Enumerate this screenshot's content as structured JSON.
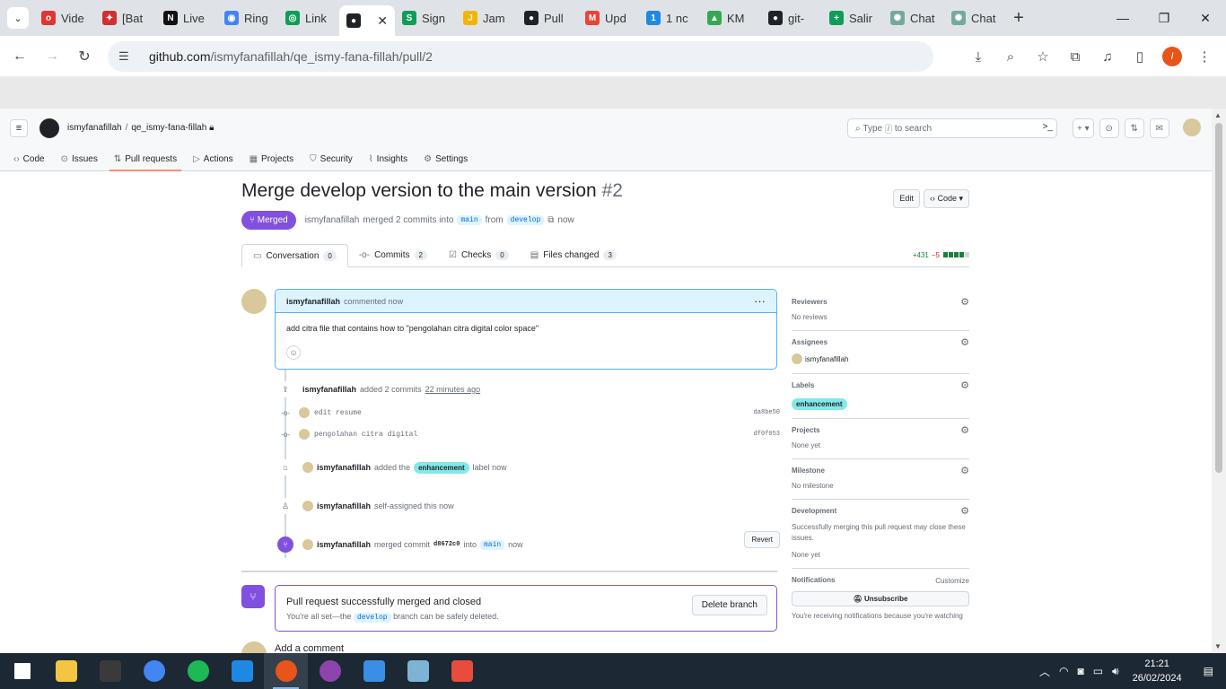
{
  "browser": {
    "tabs": [
      {
        "title": "Vide",
        "color": "#e3342f",
        "glyph": "o"
      },
      {
        "title": "[Bat",
        "color": "#d32f2f",
        "glyph": "✦"
      },
      {
        "title": "Live",
        "color": "#111111",
        "glyph": "N"
      },
      {
        "title": "Ring",
        "color": "#4285f4",
        "glyph": "◉"
      },
      {
        "title": "Link",
        "color": "#0f9d58",
        "glyph": "◎"
      },
      {
        "title": "",
        "color": "#1f2328",
        "glyph": "●",
        "active": true
      },
      {
        "title": "Sign",
        "color": "#0f9d58",
        "glyph": "S"
      },
      {
        "title": "Jam",
        "color": "#f4b400",
        "glyph": "J"
      },
      {
        "title": "Pull",
        "color": "#1f2328",
        "glyph": "●"
      },
      {
        "title": "Upd",
        "color": "#ea4335",
        "glyph": "M"
      },
      {
        "title": "1 nc",
        "color": "#1e88e5",
        "glyph": "1"
      },
      {
        "title": "KM",
        "color": "#34a853",
        "glyph": "▲"
      },
      {
        "title": "git-",
        "color": "#1f2328",
        "glyph": "●"
      },
      {
        "title": "Salir",
        "color": "#0f9d58",
        "glyph": "+"
      },
      {
        "title": "Chat",
        "color": "#74aa9c",
        "glyph": "✺"
      },
      {
        "title": "Chat",
        "color": "#74aa9c",
        "glyph": "✺"
      }
    ],
    "url_host": "github.com",
    "url_path": "/ismyfanafillah/qe_ismy-fana-fillah/pull/2",
    "profile_initial": "I"
  },
  "github": {
    "owner": "ismyfanafillah",
    "repo": "qe_ismy-fana-fillah",
    "search_placeholder_a": "Type",
    "search_placeholder_key": "/",
    "search_placeholder_b": "to search",
    "nav": [
      {
        "icon": "code-icon",
        "glyph": "‹›",
        "label": "Code"
      },
      {
        "icon": "issues-icon",
        "glyph": "⊙",
        "label": "Issues"
      },
      {
        "icon": "pull-request-icon",
        "glyph": "⇅",
        "label": "Pull requests",
        "selected": true
      },
      {
        "icon": "actions-icon",
        "glyph": "▷",
        "label": "Actions"
      },
      {
        "icon": "projects-icon",
        "glyph": "▦",
        "label": "Projects"
      },
      {
        "icon": "security-icon",
        "glyph": "⛉",
        "label": "Security"
      },
      {
        "icon": "insights-icon",
        "glyph": "⌇",
        "label": "Insights"
      },
      {
        "icon": "settings-icon",
        "glyph": "⚙",
        "label": "Settings"
      }
    ]
  },
  "pr": {
    "title": "Merge develop version to the main version",
    "number": "#2",
    "edit_label": "Edit",
    "code_label": "Code",
    "state": "Merged",
    "author": "ismyfanafillah",
    "merged_text": "merged 2 commits into",
    "base": "main",
    "from_text": "from",
    "head": "develop",
    "time": "now",
    "tabs": [
      {
        "label": "Conversation",
        "count": "0",
        "icon": "conversation-icon",
        "glyph": "▭"
      },
      {
        "label": "Commits",
        "count": "2",
        "icon": "commits-icon",
        "glyph": "-o-"
      },
      {
        "label": "Checks",
        "count": "0",
        "icon": "checks-icon",
        "glyph": "☑"
      },
      {
        "label": "Files changed",
        "count": "3",
        "icon": "files-icon",
        "glyph": "▤"
      }
    ],
    "additions": "+431",
    "deletions": "−5",
    "comment": {
      "author": "ismyfanafillah",
      "action": "commented now",
      "body": "add citra file that contains how to \"pengolahan citra digital color space\""
    },
    "commits_event": {
      "author": "ismyfanafillah",
      "text": "added 2 commits",
      "time": "22 minutes ago"
    },
    "commits": [
      {
        "message": "edit resume",
        "sha": "da8be50"
      },
      {
        "message": "pengolahan citra digital",
        "sha": "df0f053"
      }
    ],
    "label_event": {
      "author": "ismyfanafillah",
      "before": "added the",
      "label": "enhancement",
      "after": "label now"
    },
    "assign_event": {
      "author": "ismyfanafillah",
      "text": "self-assigned this now"
    },
    "merge_event": {
      "author": "ismyfanafillah",
      "text": "merged commit",
      "sha": "d8672c0",
      "into": "into",
      "base": "main",
      "time": "now",
      "revert": "Revert"
    },
    "merged_box": {
      "title": "Pull request successfully merged and closed",
      "sub_a": "You're all set—the",
      "branch": "develop",
      "sub_b": "branch can be safely deleted.",
      "delete_label": "Delete branch"
    },
    "add_comment": "Add a comment"
  },
  "sidebar": {
    "reviewers": {
      "h": "Reviewers",
      "v": "No reviews"
    },
    "assignees": {
      "h": "Assignees",
      "v": "ismyfanafillah"
    },
    "labels": {
      "h": "Labels",
      "v": "enhancement"
    },
    "projects": {
      "h": "Projects",
      "v": "None yet"
    },
    "milestone": {
      "h": "Milestone",
      "v": "No milestone"
    },
    "development": {
      "h": "Development",
      "desc": "Successfully merging this pull request may close these issues.",
      "v": "None yet"
    },
    "notifications": {
      "h": "Notifications",
      "customize": "Customize",
      "unsubscribe": "Unsubscribe",
      "note": "You're receiving notifications because you're watching"
    }
  },
  "taskbar": {
    "apps": [
      {
        "name": "start-button",
        "color": "#ffffff"
      },
      {
        "name": "file-explorer-icon",
        "color": "#f4c542"
      },
      {
        "name": "terminal-icon",
        "color": "#3a3a3a"
      },
      {
        "name": "chrome-icon",
        "color": "#4285f4"
      },
      {
        "name": "spotify-icon",
        "color": "#1db954"
      },
      {
        "name": "vscode-icon",
        "color": "#1e88e5"
      },
      {
        "name": "chrome-profile-icon",
        "color": "#e8541a",
        "active": true
      },
      {
        "name": "chrome-profile2-icon",
        "color": "#8e44ad"
      },
      {
        "name": "photos-icon",
        "color": "#3a8ee6"
      },
      {
        "name": "notepad-icon",
        "color": "#7fb3d5"
      },
      {
        "name": "snipping-icon",
        "color": "#e74c3c"
      }
    ],
    "time": "21:21",
    "date": "26/02/2024"
  }
}
